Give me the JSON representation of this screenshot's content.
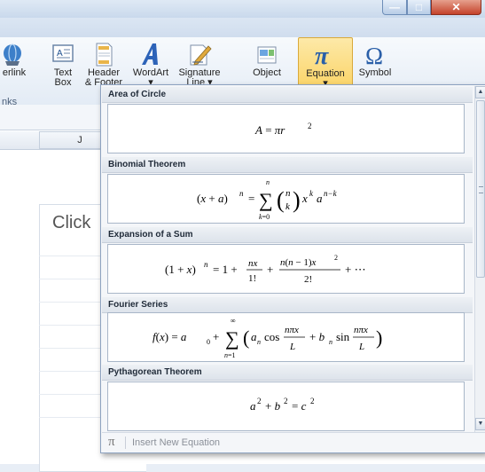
{
  "window": {
    "minimize_glyph": "—",
    "maximize_glyph": "□",
    "close_glyph": "✕"
  },
  "ribbon": {
    "group_label": "nks",
    "buttons": [
      {
        "label": "erlink",
        "label2": "",
        "icon": "hyperlink-icon"
      },
      {
        "label": "Text",
        "label2": "Box",
        "icon": "text-box-icon"
      },
      {
        "label": "Header",
        "label2": "& Footer",
        "icon": "header-footer-icon"
      },
      {
        "label": "WordArt",
        "label2": "▾",
        "icon": "wordart-icon"
      },
      {
        "label": "Signature",
        "label2": "Line ▾",
        "icon": "signature-line-icon"
      },
      {
        "label": "Object",
        "label2": "",
        "icon": "object-icon"
      },
      {
        "label": "Equation",
        "label2": "▾",
        "icon": "pi-icon"
      },
      {
        "label": "Symbol",
        "label2": "",
        "icon": "omega-icon"
      }
    ]
  },
  "sheet": {
    "column_label": "J",
    "placeholder_text": "Click"
  },
  "gallery": {
    "sections": [
      {
        "title": "Area of Circle"
      },
      {
        "title": "Binomial Theorem"
      },
      {
        "title": "Expansion of a Sum"
      },
      {
        "title": "Fourier Series"
      },
      {
        "title": "Pythagorean Theorem"
      }
    ],
    "insert_label": "Insert New Equation",
    "insert_icon": "pi-icon"
  },
  "colors": {
    "equation_highlight": "#fbd56a",
    "gallery_border": "#8da2c0",
    "close_button": "#c4422a"
  }
}
